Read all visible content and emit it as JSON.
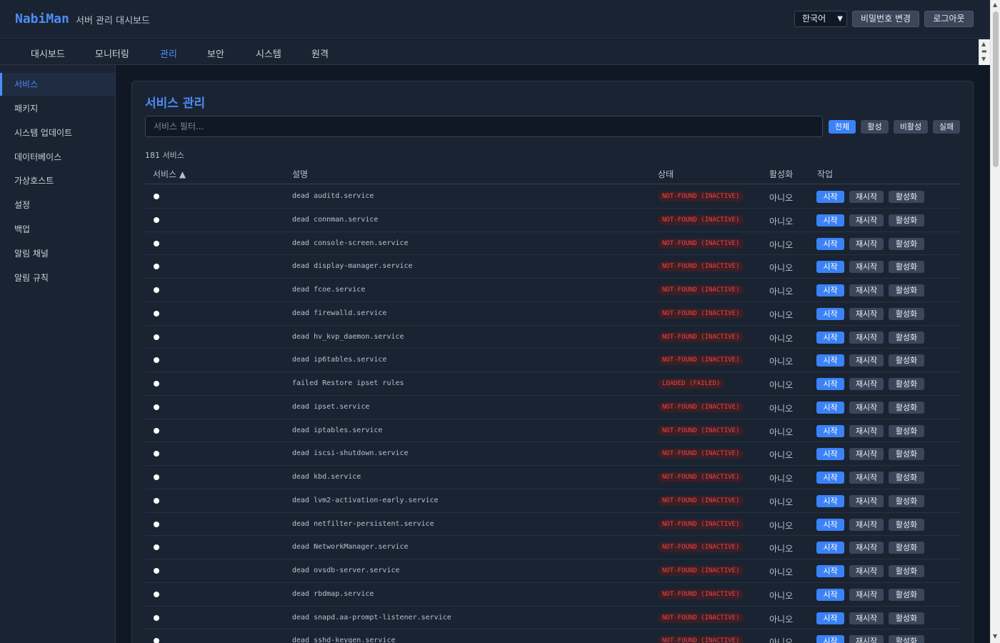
{
  "app": {
    "brand": "NabiMan",
    "subtitle": "서버 관리 대시보드"
  },
  "header": {
    "language": "한국어",
    "change_password": "비밀번호 변경",
    "logout": "로그아웃"
  },
  "nav": [
    {
      "label": "대시보드"
    },
    {
      "label": "모니터링"
    },
    {
      "label": "관리",
      "active": true
    },
    {
      "label": "보안"
    },
    {
      "label": "시스템"
    },
    {
      "label": "원격"
    }
  ],
  "sidebar": [
    {
      "label": "서비스",
      "active": true
    },
    {
      "label": "패키지"
    },
    {
      "label": "시스템 업데이트"
    },
    {
      "label": "데이터베이스"
    },
    {
      "label": "가상호스트"
    },
    {
      "label": "설정"
    },
    {
      "label": "백업"
    },
    {
      "label": "알림 채널"
    },
    {
      "label": "알림 규칙"
    }
  ],
  "services": {
    "title": "서비스 관리",
    "filter_placeholder": "서비스 필터...",
    "filters": [
      {
        "label": "전체",
        "active": true
      },
      {
        "label": "활성"
      },
      {
        "label": "비활성"
      },
      {
        "label": "실패"
      }
    ],
    "count_text": "181 서비스",
    "columns": {
      "service": "서비스 ▲",
      "description": "설명",
      "status": "상태",
      "enabled": "활성화",
      "actions": "작업"
    },
    "action_labels": {
      "start": "시작",
      "restart": "재시작",
      "enable": "활성화"
    },
    "rows": [
      {
        "desc": "dead auditd.service",
        "status": "NOT-FOUND (INACTIVE)",
        "enabled": "아니오"
      },
      {
        "desc": "dead connman.service",
        "status": "NOT-FOUND (INACTIVE)",
        "enabled": "아니오"
      },
      {
        "desc": "dead console-screen.service",
        "status": "NOT-FOUND (INACTIVE)",
        "enabled": "아니오"
      },
      {
        "desc": "dead display-manager.service",
        "status": "NOT-FOUND (INACTIVE)",
        "enabled": "아니오"
      },
      {
        "desc": "dead fcoe.service",
        "status": "NOT-FOUND (INACTIVE)",
        "enabled": "아니오"
      },
      {
        "desc": "dead firewalld.service",
        "status": "NOT-FOUND (INACTIVE)",
        "enabled": "아니오"
      },
      {
        "desc": "dead hv_kvp_daemon.service",
        "status": "NOT-FOUND (INACTIVE)",
        "enabled": "아니오"
      },
      {
        "desc": "dead ip6tables.service",
        "status": "NOT-FOUND (INACTIVE)",
        "enabled": "아니오"
      },
      {
        "desc": "failed Restore ipset rules",
        "status": "LOADED (FAILED)",
        "enabled": "아니오"
      },
      {
        "desc": "dead ipset.service",
        "status": "NOT-FOUND (INACTIVE)",
        "enabled": "아니오"
      },
      {
        "desc": "dead iptables.service",
        "status": "NOT-FOUND (INACTIVE)",
        "enabled": "아니오"
      },
      {
        "desc": "dead iscsi-shutdown.service",
        "status": "NOT-FOUND (INACTIVE)",
        "enabled": "아니오"
      },
      {
        "desc": "dead kbd.service",
        "status": "NOT-FOUND (INACTIVE)",
        "enabled": "아니오"
      },
      {
        "desc": "dead lvm2-activation-early.service",
        "status": "NOT-FOUND (INACTIVE)",
        "enabled": "아니오"
      },
      {
        "desc": "dead netfilter-persistent.service",
        "status": "NOT-FOUND (INACTIVE)",
        "enabled": "아니오"
      },
      {
        "desc": "dead NetworkManager.service",
        "status": "NOT-FOUND (INACTIVE)",
        "enabled": "아니오"
      },
      {
        "desc": "dead ovsdb-server.service",
        "status": "NOT-FOUND (INACTIVE)",
        "enabled": "아니오"
      },
      {
        "desc": "dead rbdmap.service",
        "status": "NOT-FOUND (INACTIVE)",
        "enabled": "아니오"
      },
      {
        "desc": "dead snapd.aa-prompt-listener.service",
        "status": "NOT-FOUND (INACTIVE)",
        "enabled": "아니오"
      },
      {
        "desc": "dead sshd-keygen.service",
        "status": "NOT-FOUND (INACTIVE)",
        "enabled": "아니오"
      }
    ]
  },
  "colors": {
    "accent": "#4d8df7",
    "primary_button": "#3b82f6",
    "danger": "#ef4444",
    "background": "#101826",
    "surface": "#1a2332"
  },
  "icons": {
    "language_dropdown": "chevron-down-icon",
    "status_indicator": "dot-icon",
    "sort": "sort-ascending-icon"
  }
}
